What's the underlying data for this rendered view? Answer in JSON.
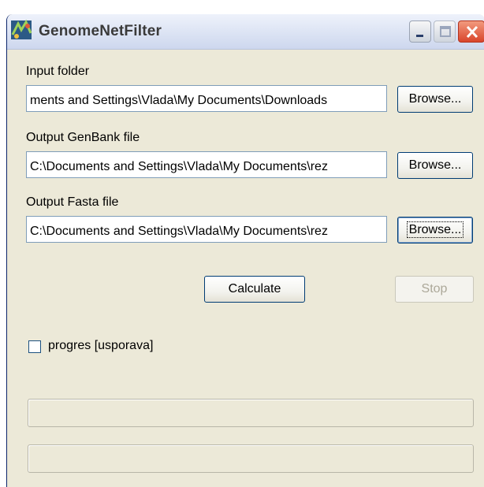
{
  "window": {
    "title": "GenomeNetFilter",
    "icon": "genome-app-icon"
  },
  "titlebar_buttons": {
    "minimize": "minimize-icon",
    "maximize": "maximize-icon",
    "close": "close-icon"
  },
  "form": {
    "input_folder": {
      "label": "Input folder",
      "value": "ments and Settings\\Vlada\\My Documents\\Downloads",
      "browse_label": "Browse..."
    },
    "output_genbank": {
      "label": "Output GenBank file",
      "value": "C:\\Documents and Settings\\Vlada\\My Documents\\rez",
      "browse_label": "Browse..."
    },
    "output_fasta": {
      "label": "Output Fasta file",
      "value": "C:\\Documents and Settings\\Vlada\\My Documents\\rez",
      "browse_label": "Browse..."
    }
  },
  "actions": {
    "calculate_label": "Calculate",
    "stop_label": "Stop"
  },
  "progress_option": {
    "label": "progres [usporava]",
    "checked": false
  },
  "progress_bars": [
    {
      "value": 0
    },
    {
      "value": 0
    }
  ],
  "colors": {
    "window_bg": "#ECE9D8",
    "input_border": "#7F9DB9",
    "button_border": "#003C74",
    "disabled_text": "#ACA899"
  }
}
